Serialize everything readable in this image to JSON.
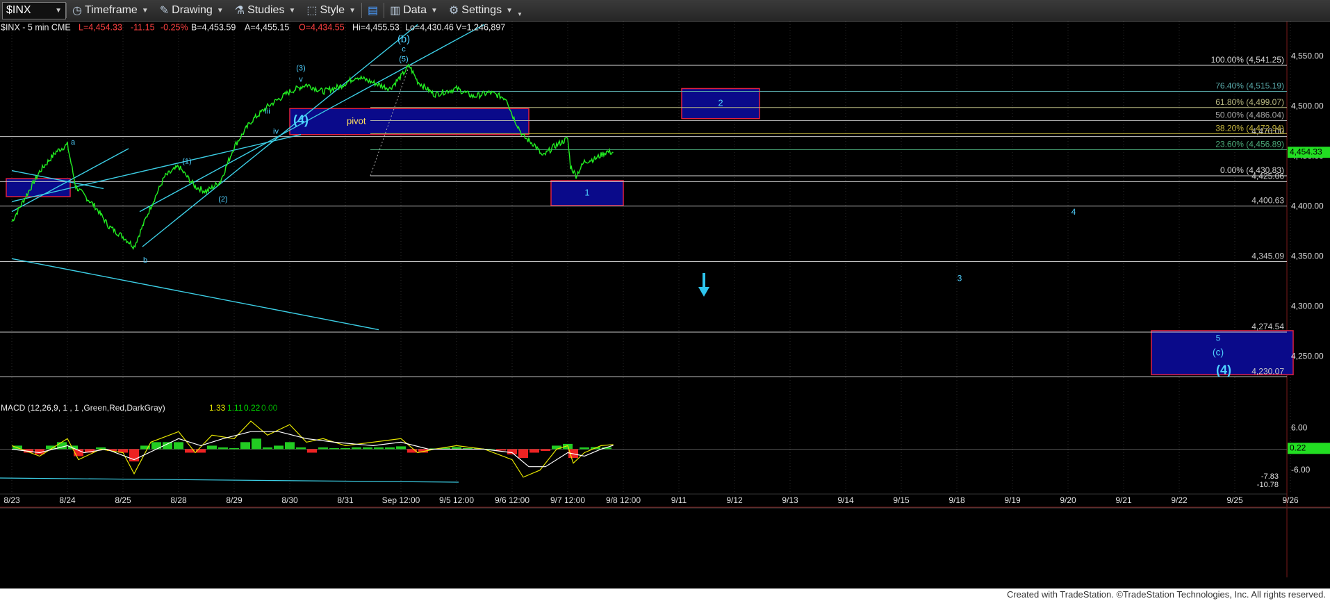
{
  "toolbar": {
    "symbol": "$INX",
    "timeframe": "Timeframe",
    "drawing": "Drawing",
    "studies": "Studies",
    "style": "Style",
    "data": "Data",
    "settings": "Settings"
  },
  "header": {
    "label": "$INX - 5 min  CME",
    "last": "L=4,454.33",
    "change": "-11.15",
    "pct": "-0.25%",
    "bid": "B=4,453.59",
    "ask": "A=4,455.15",
    "open": "O=4,434.55",
    "high": "Hi=4,455.53",
    "low": "Lo=4,430.46",
    "volume": "V=1,246,897"
  },
  "chart_data": {
    "type": "line",
    "symbol": "$INX",
    "interval": "5 min",
    "ylim": [
      4210,
      4585
    ],
    "price_ticks": [
      4550,
      4500,
      4450,
      4400,
      4350,
      4300,
      4250
    ],
    "price_tick_labels": [
      "4,550.00",
      "4,500.00",
      "4,450.00",
      "4,400.00",
      "4,350.00",
      "4,300.00",
      "4,250.00"
    ],
    "last_price": 4454.33,
    "last_price_label": "4,454.33",
    "x_labels": [
      "8/23",
      "8/24",
      "8/25",
      "8/28",
      "8/29",
      "8/30",
      "8/31",
      "Sep 12:00",
      "9/5 12:00",
      "9/6 12:00",
      "9/7 12:00",
      "9/8 12:00",
      "9/11",
      "9/12",
      "9/13",
      "9/14",
      "9/15",
      "9/18",
      "9/19",
      "9/20",
      "9/21",
      "9/22",
      "9/25",
      "9/26"
    ],
    "path": [
      [
        0,
        4385
      ],
      [
        0.25,
        4410
      ],
      [
        0.5,
        4435
      ],
      [
        0.8,
        4455
      ],
      [
        1.0,
        4462
      ],
      [
        1.15,
        4420
      ],
      [
        1.5,
        4400
      ],
      [
        1.75,
        4380
      ],
      [
        2.0,
        4370
      ],
      [
        2.2,
        4360
      ],
      [
        2.5,
        4400
      ],
      [
        2.75,
        4430
      ],
      [
        3.0,
        4440
      ],
      [
        3.3,
        4420
      ],
      [
        3.5,
        4415
      ],
      [
        3.75,
        4425
      ],
      [
        4.0,
        4460
      ],
      [
        4.3,
        4485
      ],
      [
        4.6,
        4500
      ],
      [
        5.0,
        4515
      ],
      [
        5.3,
        4522
      ],
      [
        5.6,
        4515
      ],
      [
        5.9,
        4520
      ],
      [
        6.2,
        4530
      ],
      [
        6.5,
        4524
      ],
      [
        6.8,
        4518
      ],
      [
        7.0,
        4530
      ],
      [
        7.15,
        4541
      ],
      [
        7.3,
        4525
      ],
      [
        7.6,
        4512
      ],
      [
        8.0,
        4518
      ],
      [
        8.3,
        4510
      ],
      [
        8.6,
        4514
      ],
      [
        8.9,
        4508
      ],
      [
        9.0,
        4492
      ],
      [
        9.2,
        4470
      ],
      [
        9.4,
        4462
      ],
      [
        9.55,
        4450
      ],
      [
        9.75,
        4460
      ],
      [
        10.0,
        4468
      ],
      [
        10.05,
        4440
      ],
      [
        10.15,
        4431
      ],
      [
        10.3,
        4445
      ],
      [
        10.5,
        4448
      ],
      [
        10.7,
        4455
      ],
      [
        10.82,
        4454
      ]
    ],
    "macd": {
      "label": "MACD (12,26,9, 1 , 1 ,Green,Red,DarkGray)",
      "values": [
        1.33,
        1.11,
        0.22,
        0.0
      ],
      "value_labels": [
        "1.33",
        "1.11",
        "0.22",
        "0.00"
      ],
      "ticks": [
        "6.00",
        "-6.00",
        "-7.83",
        "-10.78"
      ],
      "current_label": "0.22",
      "ylim": [
        -12,
        10
      ],
      "macd_line": [
        [
          0,
          1
        ],
        [
          0.5,
          -2
        ],
        [
          1.0,
          3
        ],
        [
          1.2,
          -3
        ],
        [
          1.6,
          0
        ],
        [
          2.0,
          -1
        ],
        [
          2.2,
          -7
        ],
        [
          2.5,
          2
        ],
        [
          3.0,
          5
        ],
        [
          3.3,
          -1
        ],
        [
          3.6,
          4
        ],
        [
          4.0,
          3
        ],
        [
          4.3,
          8
        ],
        [
          4.6,
          4
        ],
        [
          5.0,
          7
        ],
        [
          5.3,
          2
        ],
        [
          5.6,
          3
        ],
        [
          6.0,
          1
        ],
        [
          6.5,
          2
        ],
        [
          7.0,
          3
        ],
        [
          7.3,
          -1
        ],
        [
          7.6,
          0
        ],
        [
          8.0,
          1
        ],
        [
          8.5,
          0
        ],
        [
          9.0,
          -3
        ],
        [
          9.2,
          -8
        ],
        [
          9.5,
          -6
        ],
        [
          9.8,
          0
        ],
        [
          10.0,
          1
        ],
        [
          10.1,
          -4
        ],
        [
          10.3,
          -1
        ],
        [
          10.6,
          1
        ],
        [
          10.82,
          1.3
        ]
      ],
      "signal_line": [
        [
          0,
          0
        ],
        [
          0.5,
          -1
        ],
        [
          1.0,
          1
        ],
        [
          1.3,
          -1
        ],
        [
          1.7,
          0
        ],
        [
          2.2,
          -3
        ],
        [
          2.6,
          0
        ],
        [
          3.0,
          3
        ],
        [
          3.4,
          1
        ],
        [
          3.8,
          3
        ],
        [
          4.3,
          5
        ],
        [
          4.8,
          5
        ],
        [
          5.3,
          3
        ],
        [
          5.8,
          2
        ],
        [
          6.5,
          1
        ],
        [
          7.0,
          2
        ],
        [
          7.5,
          0
        ],
        [
          8.0,
          0
        ],
        [
          8.5,
          0
        ],
        [
          9.0,
          -1
        ],
        [
          9.3,
          -5
        ],
        [
          9.6,
          -5
        ],
        [
          10.0,
          -1
        ],
        [
          10.3,
          -2
        ],
        [
          10.6,
          0
        ],
        [
          10.82,
          1.1
        ]
      ],
      "histogram": [
        [
          0.1,
          1
        ],
        [
          0.3,
          -1
        ],
        [
          0.5,
          -1.5
        ],
        [
          0.7,
          1
        ],
        [
          0.9,
          2
        ],
        [
          1.1,
          1
        ],
        [
          1.2,
          -2
        ],
        [
          1.4,
          -1
        ],
        [
          1.6,
          0.5
        ],
        [
          1.8,
          -0.5
        ],
        [
          2.0,
          -1
        ],
        [
          2.2,
          -3.5
        ],
        [
          2.4,
          1
        ],
        [
          2.6,
          2
        ],
        [
          2.8,
          2
        ],
        [
          3.0,
          2
        ],
        [
          3.2,
          -1
        ],
        [
          3.4,
          -1
        ],
        [
          3.6,
          1
        ],
        [
          3.8,
          0.5
        ],
        [
          4.0,
          0.3
        ],
        [
          4.2,
          2
        ],
        [
          4.4,
          3
        ],
        [
          4.6,
          0.5
        ],
        [
          4.8,
          1
        ],
        [
          5.0,
          2
        ],
        [
          5.2,
          0.5
        ],
        [
          5.4,
          -1
        ],
        [
          5.6,
          0.5
        ],
        [
          5.8,
          0.3
        ],
        [
          6.0,
          0.3
        ],
        [
          6.2,
          0.5
        ],
        [
          6.4,
          0.5
        ],
        [
          6.6,
          0.5
        ],
        [
          6.8,
          0.5
        ],
        [
          7.0,
          0.8
        ],
        [
          7.2,
          -1
        ],
        [
          7.4,
          -1
        ],
        [
          7.6,
          0.2
        ],
        [
          7.8,
          0.4
        ],
        [
          8.0,
          0.6
        ],
        [
          8.2,
          0.3
        ],
        [
          8.4,
          0.2
        ],
        [
          8.6,
          0.1
        ],
        [
          8.8,
          -0.4
        ],
        [
          9.0,
          -1.5
        ],
        [
          9.2,
          -2.5
        ],
        [
          9.4,
          -1
        ],
        [
          9.6,
          -0.5
        ],
        [
          9.8,
          1
        ],
        [
          10.0,
          1.5
        ],
        [
          10.1,
          -2.5
        ],
        [
          10.3,
          0.5
        ],
        [
          10.5,
          0.6
        ],
        [
          10.7,
          0.5
        ]
      ]
    },
    "horizontal_lines": [
      {
        "value": 4470.0,
        "label": "4,470.00",
        "from": 0
      },
      {
        "value": 4425.06,
        "label": "4,425.06",
        "from": 0
      },
      {
        "value": 4400.63,
        "label": "4,400.63",
        "from": 0
      },
      {
        "value": 4345.09,
        "label": "4,345.09",
        "from": 0
      },
      {
        "value": 4274.54,
        "label": "4,274.54",
        "from": 0
      },
      {
        "value": 4230.07,
        "label": "4,230.07",
        "from": 0
      }
    ],
    "fib_levels": [
      {
        "value": 4541.25,
        "label": "100.00% (4,541.25)",
        "color": "#d8d8d8"
      },
      {
        "value": 4515.19,
        "label": "76.40% (4,515.19)",
        "color": "#58a8a8"
      },
      {
        "value": 4499.07,
        "label": "61.80% (4,499.07)",
        "color": "#b8b880"
      },
      {
        "value": 4486.04,
        "label": "50.00% (4,486.04)",
        "color": "#a8a8a8"
      },
      {
        "value": 4472.94,
        "label": "38.20% (4,472.94)",
        "color": "#c8b840"
      },
      {
        "value": 4456.89,
        "label": "23.60% (4,456.89)",
        "color": "#4aa878"
      },
      {
        "value": 4430.83,
        "label": "0.00% (4,430.83)",
        "color": "#d8d8d8"
      }
    ],
    "zones": [
      {
        "x0": -0.1,
        "x1": 1.05,
        "y0": 4410,
        "y1": 4428,
        "label": ""
      },
      {
        "x0": 5.0,
        "x1": 9.3,
        "y0": 4472,
        "y1": 4498,
        "label": "pivot"
      },
      {
        "x0": 12.05,
        "x1": 13.45,
        "y0": 4488,
        "y1": 4518,
        "label": "2"
      },
      {
        "x0": 9.7,
        "x1": 11.0,
        "y0": 4401,
        "y1": 4426,
        "label": "1"
      },
      {
        "x0": 20.5,
        "x1": 23.05,
        "y0": 4232,
        "y1": 4276,
        "label": ""
      }
    ],
    "wave_labels": [
      {
        "x": 1.1,
        "y": 4464,
        "text": "a"
      },
      {
        "x": 2.4,
        "y": 4346,
        "text": "b"
      },
      {
        "x": 3.15,
        "y": 4445,
        "text": "(1)"
      },
      {
        "x": 3.8,
        "y": 4407,
        "text": "(2)"
      },
      {
        "x": 4.6,
        "y": 4495,
        "text": "iii"
      },
      {
        "x": 4.75,
        "y": 4475,
        "text": "iv"
      },
      {
        "x": 5.2,
        "y": 4486,
        "text": "(4)"
      },
      {
        "x": 5.2,
        "y": 4538,
        "text": "(3)"
      },
      {
        "x": 5.2,
        "y": 4527,
        "text": "v"
      },
      {
        "x": 7.05,
        "y": 4567,
        "text": "(b)"
      },
      {
        "x": 7.05,
        "y": 4557,
        "text": "c"
      },
      {
        "x": 7.05,
        "y": 4547,
        "text": "(5)"
      },
      {
        "x": 19.1,
        "y": 4394,
        "text": "4"
      },
      {
        "x": 17.05,
        "y": 4328,
        "text": "3"
      },
      {
        "x": 21.7,
        "y": 4268,
        "text": "5"
      },
      {
        "x": 21.7,
        "y": 4254,
        "text": "(c)"
      },
      {
        "x": 21.8,
        "y": 4236,
        "text": "(4)"
      }
    ],
    "trend_lines": [
      {
        "x1": 0,
        "y1": 4395,
        "x2": 2.1,
        "y2": 4458
      },
      {
        "x1": 0,
        "y1": 4405,
        "x2": 5.2,
        "y2": 4472
      },
      {
        "x1": 2.35,
        "y1": 4360,
        "x2": 7.3,
        "y2": 4582
      },
      {
        "x1": 2.3,
        "y1": 4395,
        "x2": 8.5,
        "y2": 4582
      },
      {
        "x1": 0,
        "y1": 4436,
        "x2": 1.65,
        "y2": 4418
      },
      {
        "x1": 0,
        "y1": 4348,
        "x2": 6.6,
        "y2": 4277
      }
    ]
  },
  "footer": "Created with TradeStation. ©TradeStation Technologies, Inc. All rights reserved."
}
